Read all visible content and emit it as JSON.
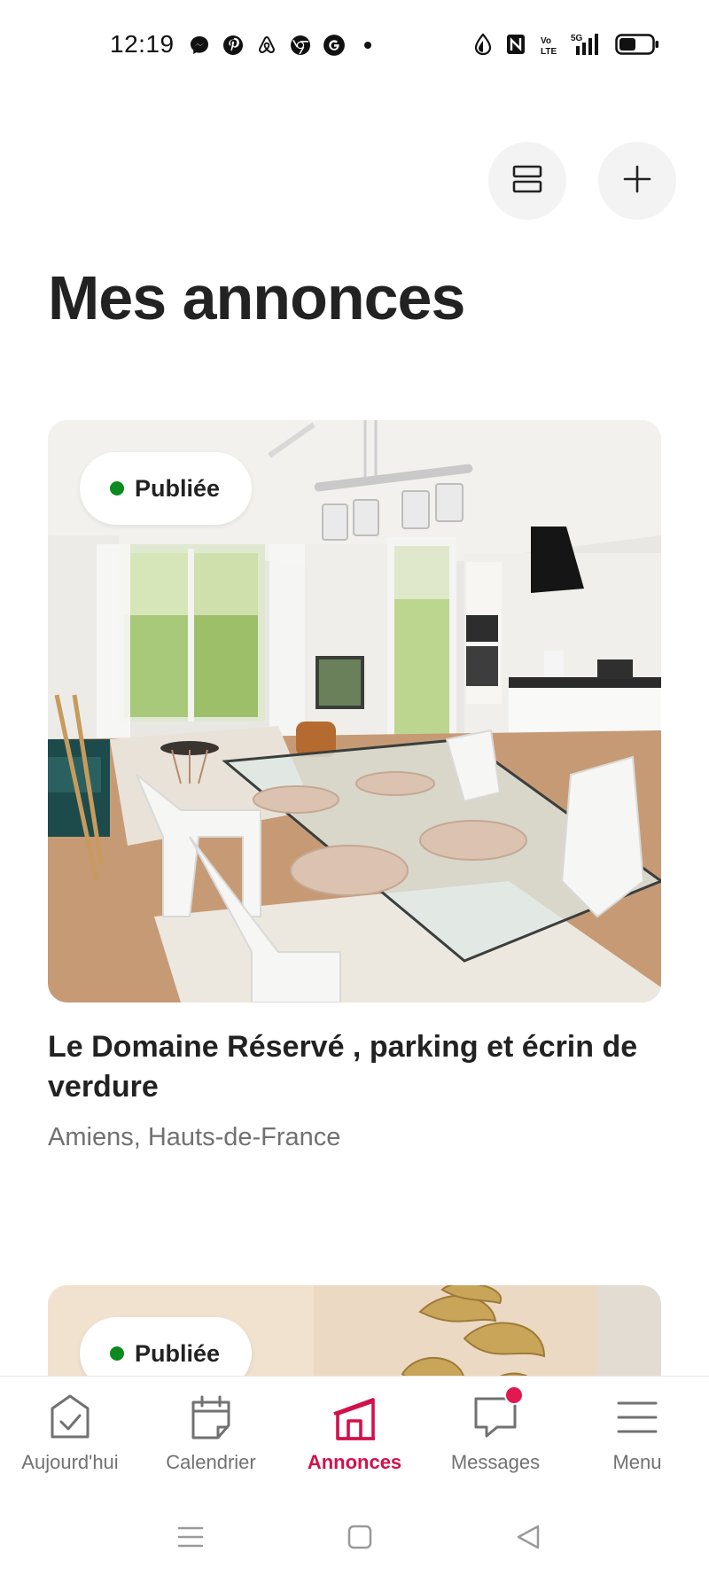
{
  "status_bar": {
    "time": "12:19",
    "app_icons": [
      "messenger-icon",
      "pinterest-icon",
      "airbnb-icon",
      "chrome-icon",
      "google-icon",
      "more-dot-icon"
    ],
    "network_label": "5G",
    "volte_label": "Vo LTE",
    "system_icons": [
      "data-saver-icon",
      "nfc-icon",
      "volte-icon",
      "signal-5g-icon",
      "battery-icon"
    ]
  },
  "top_actions": {
    "layout_icon": "view-toggle-icon",
    "add_icon": "plus-icon"
  },
  "page": {
    "title": "Mes annonces"
  },
  "listings": [
    {
      "status": "Publiée",
      "status_color": "#0a8a1f",
      "title": "Le Domaine Réservé , parking et écrin de verdure",
      "location": "Amiens, Hauts-de-France"
    },
    {
      "status": "Publiée",
      "status_color": "#0a8a1f"
    }
  ],
  "bottom_nav": {
    "items": [
      {
        "label": "Aujourd'hui",
        "icon": "today-check-icon"
      },
      {
        "label": "Calendrier",
        "icon": "calendar-icon"
      },
      {
        "label": "Annonces",
        "icon": "listings-house-icon",
        "active": true
      },
      {
        "label": "Messages",
        "icon": "messages-icon",
        "has_badge": true
      },
      {
        "label": "Menu",
        "icon": "menu-icon"
      }
    ],
    "active_color": "#d3104b"
  },
  "system_nav": {
    "icons": [
      "recents-icon",
      "home-icon",
      "back-icon"
    ]
  }
}
